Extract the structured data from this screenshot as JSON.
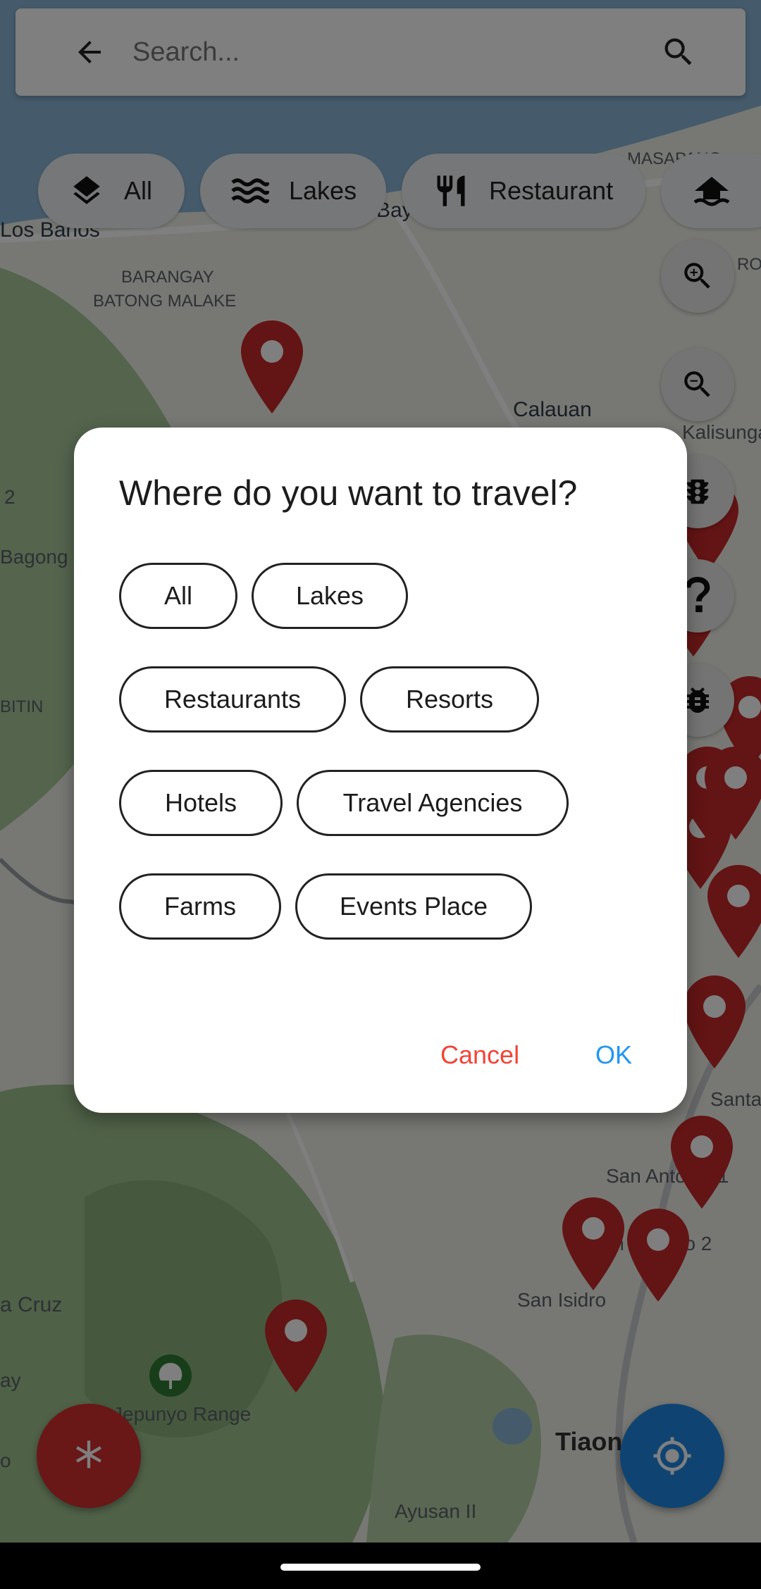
{
  "search": {
    "placeholder": "Search..."
  },
  "chips": [
    {
      "label": "All",
      "icon": "layers-icon"
    },
    {
      "label": "Lakes",
      "icon": "waves-icon"
    },
    {
      "label": "Restaurant",
      "icon": "fork-knife-icon"
    },
    {
      "label": "",
      "icon": "resort-icon"
    }
  ],
  "map_labels": {
    "los_banos": "Los Banos",
    "bay": "Bay",
    "masapang": "MASAPANG",
    "barangay": "BARANGAY",
    "batong_malake": "BATONG MALAKE",
    "calauan": "Calauan",
    "kalisunga": "Kalisunga",
    "ro": "RO",
    "two": "2",
    "bagong": "Bagong",
    "bitin": "BITIN",
    "santa": "Santa",
    "san_antonio_1": "San Antonio 1",
    "san_antonio_2": "San Antonio 2",
    "san_isidro": "San Isidro",
    "sta_cruz": "a Cruz",
    "ay": "ay",
    "o": "o",
    "jepunyo_range": "Jepunyo Range",
    "tiaong": "Tiaon",
    "ayusan": "Ayusan II"
  },
  "dialog": {
    "title": "Where do you want to travel?",
    "options": [
      "All",
      "Lakes",
      "Restaurants",
      "Resorts",
      "Hotels",
      "Travel Agencies",
      "Farms",
      "Events Place"
    ],
    "cancel": "Cancel",
    "ok": "OK"
  },
  "colors": {
    "accent_blue": "#2196F3",
    "cancel_red": "#F44336",
    "pin_red": "#C62828",
    "fab_red": "#D32F2F",
    "fab_blue": "#1E88E5"
  }
}
